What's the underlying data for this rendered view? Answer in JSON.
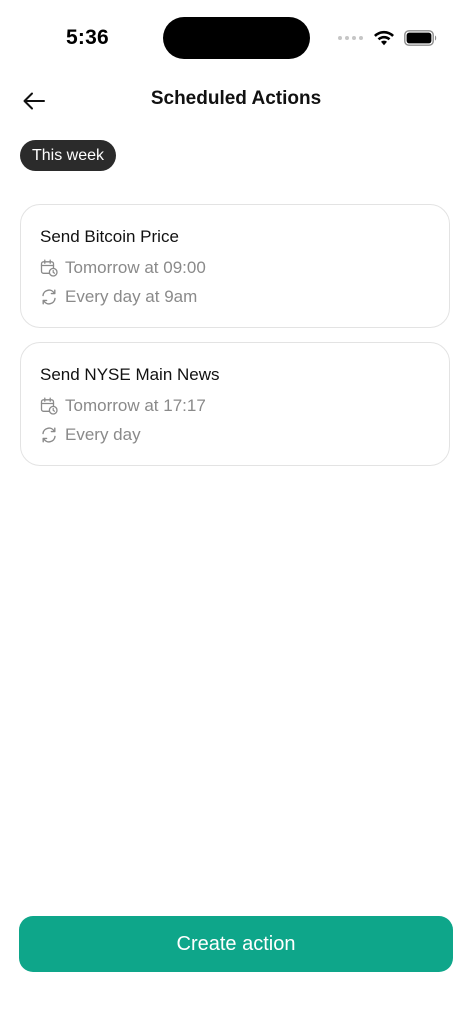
{
  "status_bar": {
    "time": "5:36"
  },
  "header": {
    "title": "Scheduled Actions",
    "back_icon": "arrow-left-icon"
  },
  "filter": {
    "chip_label": "This week"
  },
  "actions": [
    {
      "title": "Send Bitcoin Price",
      "schedule": "Tomorrow at 09:00",
      "recurrence": "Every day at 9am"
    },
    {
      "title": "Send NYSE Main News",
      "schedule": "Tomorrow at 17:17",
      "recurrence": "Every day"
    }
  ],
  "footer": {
    "create_button_label": "Create action"
  },
  "colors": {
    "accent": "#0ea68a",
    "chip_bg": "#2b2b2b",
    "muted_text": "#8a8a8a",
    "card_border": "#e3e3e3"
  }
}
